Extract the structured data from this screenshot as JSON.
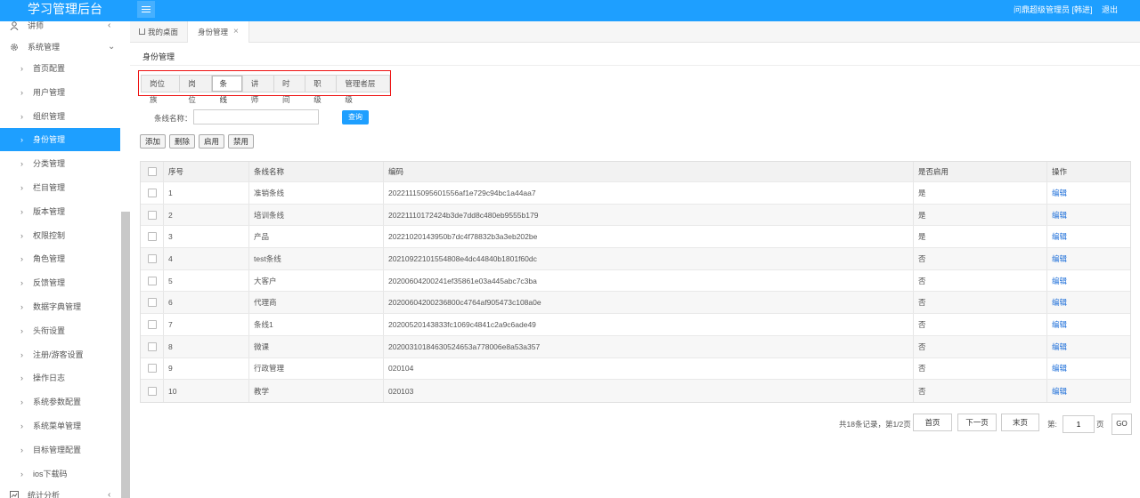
{
  "header": {
    "brand": "学习管理后台",
    "user": "问鼎超级管理员 [韩进]",
    "logout": "退出"
  },
  "sidebar": {
    "groups": [
      {
        "label": "讲师",
        "icon": "user-icon"
      },
      {
        "label": "系统管理",
        "icon": "gear-icon"
      },
      {
        "label": "统计分析",
        "icon": "chart-icon"
      }
    ],
    "items": [
      {
        "label": "首页配置"
      },
      {
        "label": "用户管理"
      },
      {
        "label": "组织管理"
      },
      {
        "label": "身份管理"
      },
      {
        "label": "分类管理"
      },
      {
        "label": "栏目管理"
      },
      {
        "label": "版本管理"
      },
      {
        "label": "权限控制"
      },
      {
        "label": "角色管理"
      },
      {
        "label": "反馈管理"
      },
      {
        "label": "数据字典管理"
      },
      {
        "label": "头衔设置"
      },
      {
        "label": "注册/游客设置"
      },
      {
        "label": "操作日志"
      },
      {
        "label": "系统参数配置"
      },
      {
        "label": "系统菜单管理"
      },
      {
        "label": "目标管理配置"
      },
      {
        "label": "ios下载码"
      }
    ],
    "active_item": "身份管理"
  },
  "tabs": {
    "home": "我的桌面",
    "current": "身份管理",
    "close": "×"
  },
  "page": {
    "title": "身份管理",
    "segments": [
      "岗位族",
      "岗位",
      "条线",
      "讲师",
      "时间",
      "职级",
      "管理者层级"
    ],
    "active_segment": "条线"
  },
  "search": {
    "label": "条线名称：",
    "value": "",
    "placeholder": "",
    "button": "查询"
  },
  "actions": {
    "add": "添加",
    "delete": "删除",
    "enable": "启用",
    "disable": "禁用"
  },
  "table": {
    "columns": [
      "序号",
      "条线名称",
      "编码",
      "是否启用",
      "操作"
    ],
    "rows": [
      {
        "no": "1",
        "name": "准销条线",
        "code": "20221115095601556af1e729c94bc1a44aa7",
        "enabled": "是",
        "op": "编辑"
      },
      {
        "no": "2",
        "name": "培训条线",
        "code": "20221110172424b3de7dd8c480eb9555b179",
        "enabled": "是",
        "op": "编辑"
      },
      {
        "no": "3",
        "name": "产品",
        "code": "20221020143950b7dc4f78832b3a3eb202be",
        "enabled": "是",
        "op": "编辑"
      },
      {
        "no": "4",
        "name": "test条线",
        "code": "20210922101554808e4dc44840b1801f60dc",
        "enabled": "否",
        "op": "编辑"
      },
      {
        "no": "5",
        "name": "大客户",
        "code": "20200604200241ef35861e03a445abc7c3ba",
        "enabled": "否",
        "op": "编辑"
      },
      {
        "no": "6",
        "name": "代理商",
        "code": "20200604200236800c4764af905473c108a0e",
        "enabled": "否",
        "op": "编辑"
      },
      {
        "no": "7",
        "name": "条线1",
        "code": "20200520143833fc1069c4841c2a9c6ade49",
        "enabled": "否",
        "op": "编辑"
      },
      {
        "no": "8",
        "name": "微课",
        "code": "20200310184630524653a778006e8a53a357",
        "enabled": "否",
        "op": "编辑"
      },
      {
        "no": "9",
        "name": "行政管理",
        "code": "020104",
        "enabled": "否",
        "op": "编辑"
      },
      {
        "no": "10",
        "name": "教学",
        "code": "020103",
        "enabled": "否",
        "op": "编辑"
      }
    ]
  },
  "pagination": {
    "info": "共18条记录，第1/2页",
    "first": "首页",
    "next": "下一页",
    "last": "末页",
    "goto_prefix": "第:",
    "page_value": "1",
    "goto_suffix": "页",
    "go": "GO"
  },
  "colors": {
    "primary": "#1e9fff",
    "highlight_border": "#ee1111",
    "link": "#1e6fd9"
  }
}
